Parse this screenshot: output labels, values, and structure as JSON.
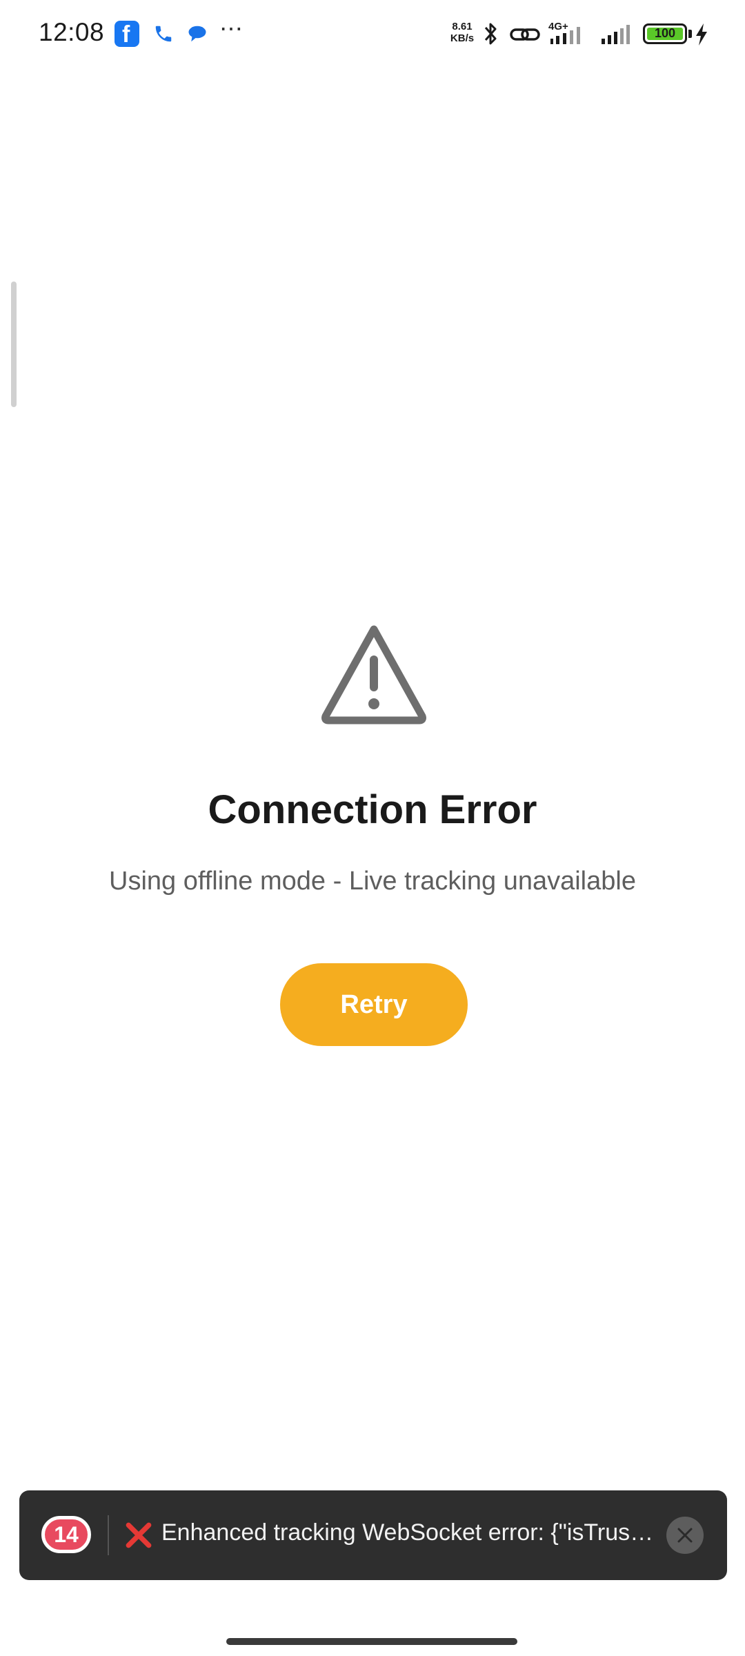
{
  "status_bar": {
    "time": "12:08",
    "net_speed_value": "8.61",
    "net_speed_unit": "KB/s",
    "network_type": "4G+",
    "battery_level": "100",
    "notification_icons": [
      "facebook-icon",
      "phone-icon",
      "chat-icon",
      "more-dots-icon"
    ],
    "system_icons": [
      "bluetooth-icon",
      "link-icon",
      "signal-icon",
      "signal-icon",
      "battery-icon",
      "charging-icon"
    ]
  },
  "error": {
    "icon": "warning-icon",
    "title": "Connection Error",
    "message": "Using offline mode - Live tracking unavailable",
    "retry_label": "Retry"
  },
  "toast": {
    "count": "14",
    "icon": "x-icon",
    "text": "Enhanced tracking WebSocket error: {\"isTrus…",
    "close_icon": "close-icon"
  },
  "colors": {
    "accent": "#f5ad1f",
    "badge": "#e84a5f",
    "toast_bg": "#2e2e2e",
    "battery": "#5ac828"
  }
}
